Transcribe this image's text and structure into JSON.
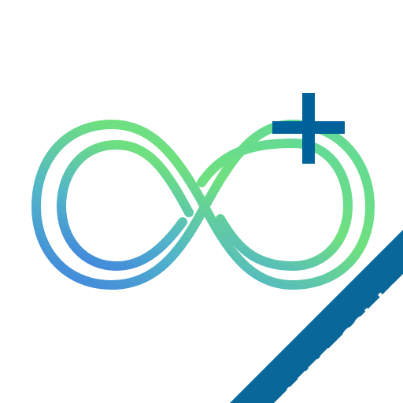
{
  "app_icon": {
    "badge_text": "LITE 32bit",
    "colors": {
      "background": "#ffffff",
      "gradient_blue": "#3f7fe0",
      "gradient_teal": "#52b6c8",
      "gradient_green": "#6fe07f",
      "plus_blue": "#00629b",
      "banner_blue": "#0a679a"
    },
    "icons": [
      "infinity-logo-icon",
      "plus-icon"
    ]
  }
}
